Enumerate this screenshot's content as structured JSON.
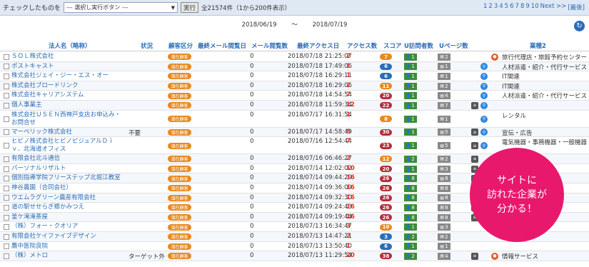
{
  "topbar": {
    "check_label": "チェックしたものを",
    "select_value": "--- 選択し実行ボタン ---",
    "exec_label": "実行",
    "total_text": "全21574件（1から200件表示）",
    "pager": [
      "1",
      "2",
      "3",
      "4",
      "5",
      "6",
      "7",
      "8",
      "9",
      "10",
      "Next >>",
      "[最後]"
    ]
  },
  "daterange": {
    "from": "2018/06/19",
    "sep": "〜",
    "to": "2018/07/19"
  },
  "columns": {
    "name": "法人名（略称）",
    "status": "状況",
    "category": "顧客区分",
    "last_mail": "最終メール閲覧日",
    "mail_count": "メール閲覧数",
    "last_access": "最終アクセス日",
    "access_count": "アクセス数",
    "score": "スコア",
    "u_visitors": "U訪問者数",
    "u_pages": "Uページ数",
    "industry": "業種2"
  },
  "rows": [
    {
      "name": "ＳＯＬ株式会社",
      "status": "",
      "badge": "潜在顧客",
      "zero": "0",
      "date": "2018/07/18 21:25:07",
      "count": "2",
      "score": "7",
      "score_color": "#e8891e",
      "uv": "1",
      "up": "2",
      "icons": [
        "tag"
      ],
      "industry": "旅行代理店・旅館予約センター"
    },
    {
      "name": "ポストキャスト",
      "status": "",
      "badge": "潜在顧客",
      "zero": "0",
      "date": "2018/07/18 17:49:06",
      "count": "1",
      "score": "6",
      "score_color": "#2a6db8",
      "uv": "1",
      "up": "1",
      "icons": [
        "srch"
      ],
      "industry": "人材派遣・紹介・代行サービス"
    },
    {
      "name": "株式会社ジェイ・ジー・エス・オー",
      "status": "",
      "badge": "潜在顧客",
      "zero": "0",
      "date": "2018/07/18 16:29:11",
      "count": "1",
      "score": "6",
      "score_color": "#2a6db8",
      "uv": "1",
      "up": "1",
      "icons": [
        "srch"
      ],
      "industry": "IT関連"
    },
    {
      "name": "株式会社ブロードリンク",
      "status": "",
      "badge": "潜在顧客",
      "zero": "0",
      "date": "2018/07/18 16:29:06",
      "count": "2",
      "score": "11",
      "score_color": "#e8891e",
      "uv": "1",
      "up": "2",
      "icons": [
        "srch"
      ],
      "industry": "IT関連"
    },
    {
      "name": "株式会社キャリアシステム",
      "status": "",
      "badge": "潜在顧客",
      "zero": "0",
      "date": "2018/07/18 14:54:54",
      "count": "7",
      "score": "20",
      "score_color": "#b22e3a",
      "uv": "1",
      "up": "4",
      "icons": [
        "srch"
      ],
      "industry": "人材派遣・紹介・代行サービス"
    },
    {
      "name": "個人事業主",
      "status": "",
      "badge": "潜在顧客",
      "zero": "0",
      "date": "2018/07/18 11:59:34",
      "count": "12",
      "score": "22",
      "score_color": "#b22e3a",
      "uv": "1",
      "up": "7",
      "icons": [
        "doc",
        "srch"
      ],
      "industry": ""
    },
    {
      "name": "株式会社ＵＳＥＮ西神戸支店お申込み・お問合せ",
      "status": "",
      "badge": "潜在顧客",
      "zero": "0",
      "date": "2018/07/17 16:31:54",
      "count": "1",
      "score": "8",
      "score_color": "#e8891e",
      "uv": "1",
      "up": "1",
      "icons": [
        "srch"
      ],
      "industry": "レンタル",
      "tall": true
    },
    {
      "name": "マーベリック株式会社",
      "status": "不要",
      "badge": "潜在顧客",
      "zero": "0",
      "date": "2018/07/17 14:58:49",
      "count": "8",
      "score": "30",
      "score_color": "#b22e3a",
      "uv": "1",
      "up": "5",
      "icons": [
        "doc",
        "srch"
      ],
      "industry": "宣伝・広告"
    },
    {
      "name": "ヒビノ株式会社ヒビノビジュアルＤｉｖ．北海道オフィス",
      "status": "",
      "badge": "潜在顧客",
      "zero": "0",
      "date": "2018/07/16 12:54:44",
      "count": "7",
      "score": "23",
      "score_color": "#b22e3a",
      "uv": "1",
      "up": "5",
      "icons": [
        "doc",
        "srch"
      ],
      "industry": "電気機器・事務機器・一般機器",
      "tall": true
    },
    {
      "name": "有限会社北斗通信",
      "status": "",
      "badge": "潜在顧客",
      "zero": "0",
      "date": "2018/07/16 06:46:27",
      "count": "2",
      "score": "12",
      "score_color": "#e8891e",
      "uv": "2",
      "up": "2",
      "icons": [
        "doc"
      ],
      "industry": ""
    },
    {
      "name": "パーソナルリザルト",
      "status": "",
      "badge": "潜在顧客",
      "zero": "0",
      "date": "2018/07/14 12:02:02",
      "count": "10",
      "score": "20",
      "score_color": "#b22e3a",
      "uv": "1",
      "up": "3",
      "icons": [
        "doc"
      ],
      "industry": ""
    },
    {
      "name": "個別指導学院フリーステップ北堀江教室",
      "status": "",
      "badge": "潜在顧客",
      "zero": "0",
      "date": "2018/07/14 09:44:29",
      "count": "16",
      "score": "26",
      "score_color": "#b22e3a",
      "uv": "8",
      "up": "8",
      "icons": [
        "doc"
      ],
      "industry": ""
    },
    {
      "name": "神谷農園（合同会社）",
      "status": "",
      "badge": "潜在顧客",
      "zero": "0",
      "date": "2018/07/14 09:36:09",
      "count": "16",
      "score": "26",
      "score_color": "#b22e3a",
      "uv": "8",
      "up": "8",
      "icons": [
        "doc"
      ],
      "industry": ""
    },
    {
      "name": "ウエムラグリーン農産有限会社",
      "status": "",
      "badge": "潜在顧客",
      "zero": "0",
      "date": "2018/07/14 09:32:30",
      "count": "16",
      "score": "26",
      "score_color": "#b22e3a",
      "uv": "8",
      "up": "8",
      "icons": [
        "doc"
      ],
      "industry": ""
    },
    {
      "name": "道の駅せせらぎ郷かみつえ",
      "status": "",
      "badge": "潜在顧客",
      "zero": "0",
      "date": "2018/07/14 09:24:43",
      "count": "16",
      "score": "26",
      "score_color": "#b22e3a",
      "uv": "8",
      "up": "8",
      "icons": [
        "doc"
      ],
      "industry": ""
    },
    {
      "name": "釜ケ滝滝茶屋",
      "status": "",
      "badge": "潜在顧客",
      "zero": "0",
      "date": "2018/07/14 09:19:44",
      "count": "16",
      "score": "26",
      "score_color": "#b22e3a",
      "uv": "8",
      "up": "8",
      "icons": [
        "doc"
      ],
      "industry": ""
    },
    {
      "name": "（株）フォー・クオリア",
      "status": "",
      "badge": "潜在顧客",
      "zero": "0",
      "date": "2018/07/13 16:34:47",
      "count": "3",
      "score": "10",
      "score_color": "#e8891e",
      "uv": "1",
      "up": "3",
      "icons": [],
      "industry": ""
    },
    {
      "name": "有限会社ケイファイブデザイン",
      "status": "",
      "badge": "潜在顧客",
      "zero": "0",
      "date": "2018/07/13 14:47:21",
      "count": "2",
      "score": "3",
      "score_color": "#2a6db8",
      "uv": "2",
      "up": "2",
      "icons": [],
      "industry": ""
    },
    {
      "name": "鷹中医院良院",
      "status": "",
      "badge": "潜在顧客",
      "zero": "0",
      "date": "2018/07/13 13:50:40",
      "count": "1",
      "score": "6",
      "score_color": "#2a6db8",
      "uv": "1",
      "up": "1",
      "icons": [],
      "industry": ""
    },
    {
      "name": "（株）メトロ",
      "status": "ターゲット外",
      "badge": "潜在顧客",
      "zero": "0",
      "date": "2018/07/13 11:29:54",
      "count": "20",
      "score": "38",
      "score_color": "#b22e3a",
      "uv": "2",
      "up": "4",
      "icons": [
        "doc",
        "tag"
      ],
      "industry": "情報サービス"
    }
  ],
  "callout": {
    "line1": "サイトに",
    "line2": "訪れた企業が",
    "line3": "分かる！"
  }
}
